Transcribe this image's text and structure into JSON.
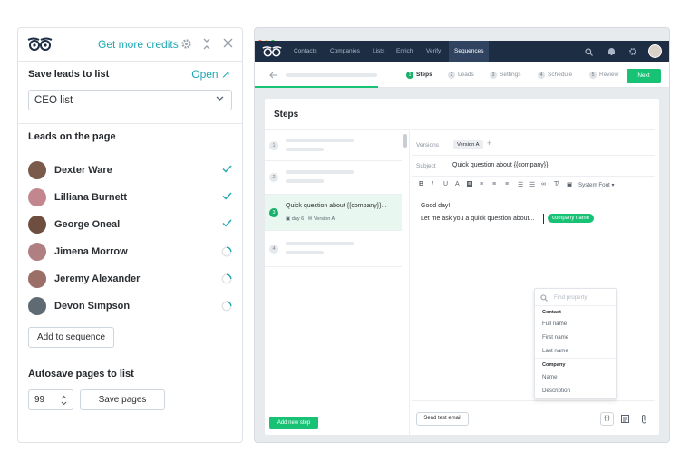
{
  "panel": {
    "credits": "Get more credits",
    "save_title": "Save leads to list",
    "open": "Open ↗",
    "list_value": "CEO list",
    "leads_title": "Leads on the page",
    "leads": [
      {
        "name": "Dexter Ware",
        "status": "done"
      },
      {
        "name": "Lilliana Burnett",
        "status": "done"
      },
      {
        "name": "George Oneal",
        "status": "done"
      },
      {
        "name": "Jimena Morrow",
        "status": "loading"
      },
      {
        "name": "Jeremy Alexander",
        "status": "loading"
      },
      {
        "name": "Devon Simpson",
        "status": "loading"
      }
    ],
    "add_btn": "Add to sequence",
    "autosave_title": "Autosave pages to list",
    "pages_value": "99",
    "save_pages": "Save pages"
  },
  "app": {
    "nav": [
      "Contacts",
      "Companies",
      "Lists",
      "Enrich",
      "Verify",
      "Sequences"
    ],
    "steps": [
      {
        "n": "1",
        "label": "Steps"
      },
      {
        "n": "2",
        "label": "Leads"
      },
      {
        "n": "3",
        "label": "Settings"
      },
      {
        "n": "4",
        "label": "Schedule"
      },
      {
        "n": "5",
        "label": "Review"
      }
    ],
    "next": "Next",
    "title": "Steps",
    "step3_title": "Quick question about {{company}}...",
    "step3_day": "day 6",
    "step3_version": "Version A",
    "step_nums": [
      "1",
      "2",
      "3",
      "4"
    ],
    "add_step": "Add new step",
    "versions_label": "Versions",
    "version_chip": "Version A",
    "subject_label": "Subject",
    "subject": "Quick question about {{company}}",
    "toolbar": [
      "B",
      "I",
      "U",
      "A",
      "≡",
      "≡",
      "≡",
      "≡",
      "☰",
      "☰",
      "∞",
      "T̸",
      "▣"
    ],
    "font": "System Font ▾",
    "body1": "Good day!",
    "body2": "Let me ask you a quick question about...",
    "company_chip": "company name",
    "find": "Find property",
    "contact_h": "Contact",
    "contact_items": [
      "Full name",
      "First name",
      "Last name"
    ],
    "company_h": "Company",
    "company_items": [
      "Name",
      "Description"
    ],
    "test_email": "Send test email",
    "var_btn": "{-}"
  }
}
